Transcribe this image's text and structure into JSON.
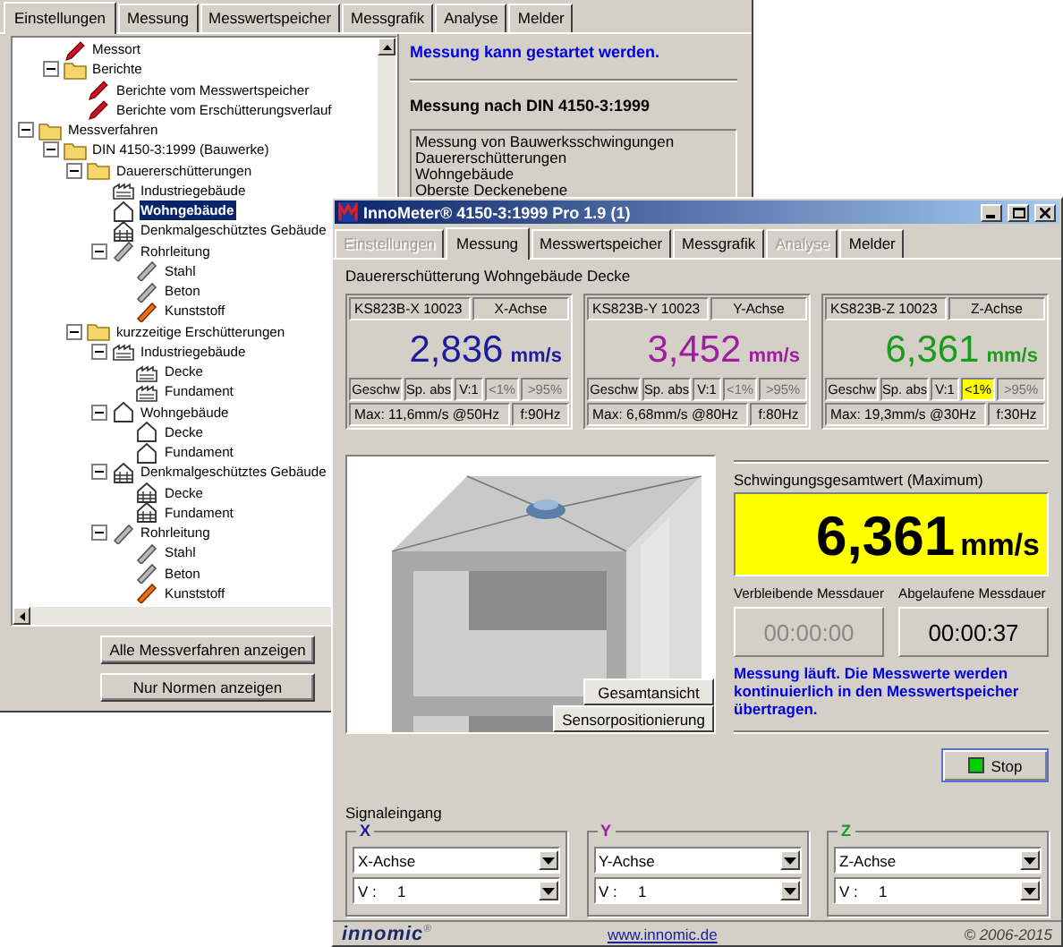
{
  "back_window": {
    "tabs": [
      {
        "label": "Einstellungen",
        "selected": true
      },
      {
        "label": "Messung",
        "selected": false
      },
      {
        "label": "Messwertspeicher",
        "selected": false
      },
      {
        "label": "Messgrafik",
        "selected": false
      },
      {
        "label": "Analyse",
        "selected": false
      },
      {
        "label": "Melder",
        "selected": false
      }
    ],
    "tree": {
      "items": [
        {
          "children": [
            {
              "label": "Messort",
              "kind": "report",
              "selected": false
            },
            {
              "label": "Berichte",
              "kind": "folder",
              "selected": false,
              "expanded": true,
              "children": [
                {
                  "label": "Berichte vom Messwertspeicher",
                  "kind": "report",
                  "selected": false
                },
                {
                  "label": "Berichte vom Erschütterungsverlauf",
                  "kind": "report",
                  "selected": false
                }
              ]
            }
          ]
        },
        {
          "label": "Messverfahren",
          "kind": "folder",
          "selected": false,
          "expanded": true,
          "children": [
            {
              "label": "DIN 4150-3:1999 (Bauwerke)",
              "kind": "folder",
              "selected": false,
              "expanded": true,
              "children": [
                {
                  "label": "Dauererschütterungen",
                  "kind": "folder",
                  "selected": false,
                  "expanded": true,
                  "children": [
                    {
                      "label": "Industriegebäude",
                      "kind": "factory",
                      "selected": false
                    },
                    {
                      "label": "Wohngebäude",
                      "kind": "house",
                      "selected": true
                    },
                    {
                      "label": "Denkmalgeschütztes Gebäude",
                      "kind": "monument",
                      "selected": false
                    },
                    {
                      "label": "Rohrleitung",
                      "kind": "pipe",
                      "selected": false,
                      "expanded": true,
                      "children": [
                        {
                          "label": "Stahl",
                          "kind": "pipe",
                          "selected": false
                        },
                        {
                          "label": "Beton",
                          "kind": "pipe",
                          "selected": false
                        },
                        {
                          "label": "Kunststoff",
                          "kind": "plastic",
                          "selected": false
                        }
                      ]
                    }
                  ]
                },
                {
                  "label": "kurzzeitige Erschütterungen",
                  "kind": "folder",
                  "selected": false,
                  "expanded": true,
                  "children": [
                    {
                      "label": "Industriegebäude",
                      "kind": "factory",
                      "selected": false,
                      "expanded": true,
                      "children": [
                        {
                          "label": "Decke",
                          "kind": "factory",
                          "selected": false
                        },
                        {
                          "label": "Fundament",
                          "kind": "factory",
                          "selected": false
                        }
                      ]
                    },
                    {
                      "label": "Wohngebäude",
                      "kind": "house",
                      "selected": false,
                      "expanded": true,
                      "children": [
                        {
                          "label": "Decke",
                          "kind": "house",
                          "selected": false
                        },
                        {
                          "label": "Fundament",
                          "kind": "house",
                          "selected": false
                        }
                      ]
                    },
                    {
                      "label": "Denkmalgeschütztes Gebäude",
                      "kind": "monument",
                      "selected": false,
                      "expanded": true,
                      "children": [
                        {
                          "label": "Decke",
                          "kind": "monument",
                          "selected": false
                        },
                        {
                          "label": "Fundament",
                          "kind": "monument",
                          "selected": false
                        }
                      ]
                    },
                    {
                      "label": "Rohrleitung",
                      "kind": "pipe",
                      "selected": false,
                      "expanded": true,
                      "children": [
                        {
                          "label": "Stahl",
                          "kind": "pipe",
                          "selected": false
                        },
                        {
                          "label": "Beton",
                          "kind": "pipe",
                          "selected": false
                        },
                        {
                          "label": "Kunststoff",
                          "kind": "plastic",
                          "selected": false
                        }
                      ]
                    }
                  ]
                }
              ]
            }
          ]
        }
      ]
    },
    "buttons": [
      "Alle Messverfahren anzeigen",
      "Nur Normen anzeigen"
    ],
    "status": "Messung kann gestartet werden.",
    "heading": "Messung nach DIN 4150-3:1999",
    "description": [
      "Messung von Bauwerksschwingungen",
      "Dauererschütterungen",
      "Wohngebäude",
      "Oberste Deckenebene"
    ]
  },
  "front_window": {
    "title": "InnoMeter® 4150-3:1999 Pro 1.9 (1)",
    "tabs": [
      {
        "label": "Einstellungen",
        "selected": false,
        "disabled": true
      },
      {
        "label": "Messung",
        "selected": true,
        "disabled": false
      },
      {
        "label": "Messwertspeicher",
        "selected": false,
        "disabled": false
      },
      {
        "label": "Messgrafik",
        "selected": false,
        "disabled": false
      },
      {
        "label": "Analyse",
        "selected": false,
        "disabled": true
      },
      {
        "label": "Melder",
        "selected": false,
        "disabled": false
      }
    ],
    "measurement_title": "Dauererschütterung Wohngebäude Decke",
    "channels": [
      {
        "sensor": "KS823B-X 10023",
        "axis": "X-Achse",
        "value": "2,836",
        "unit": "mm/s",
        "color": "#1c1c9c",
        "cells": [
          "Geschw",
          "Sp. abs",
          "V:1"
        ],
        "flags": [
          {
            "label": "<1%",
            "on": false
          },
          {
            "label": ">95%",
            "on": false
          }
        ],
        "max": "Max: 11,6mm/s @50Hz",
        "frequency": "f:90Hz"
      },
      {
        "sensor": "KS823B-Y 10023",
        "axis": "Y-Achse",
        "value": "3,452",
        "unit": "mm/s",
        "color": "#a01ca0",
        "cells": [
          "Geschw",
          "Sp. abs",
          "V:1"
        ],
        "flags": [
          {
            "label": "<1%",
            "on": false
          },
          {
            "label": ">95%",
            "on": false
          }
        ],
        "max": "Max: 6,68mm/s @80Hz",
        "frequency": "f:80Hz"
      },
      {
        "sensor": "KS823B-Z 10023",
        "axis": "Z-Achse",
        "value": "6,361",
        "unit": "mm/s",
        "color": "#1c9c1c",
        "cells": [
          "Geschw",
          "Sp. abs",
          "V:1"
        ],
        "flags": [
          {
            "label": "<1%",
            "on": true
          },
          {
            "label": ">95%",
            "on": false
          }
        ],
        "max": "Max: 19,3mm/s @30Hz",
        "frequency": "f:30Hz"
      }
    ],
    "view_buttons": [
      "Gesamtansicht",
      "Sensorpositionierung"
    ],
    "total": {
      "label": "Schwingungsgesamtwert (Maximum)",
      "value": "6,361",
      "unit": "mm/s"
    },
    "timers": [
      {
        "label": "Verbleibende Messdauer",
        "value": "00:00:00",
        "disabled": true
      },
      {
        "label": "Abgelaufene Messdauer",
        "value": "00:00:37",
        "disabled": false
      }
    ],
    "message": "Messung läuft. Die Messwerte werden kontinuierlich in den Messwertspeicher übertragen.",
    "stop_button": "Stop",
    "signal_input": {
      "label": "Signaleingang",
      "groups": [
        {
          "name": "X",
          "color": "#1c1c9c",
          "axis": "X-Achse",
          "gain_label": "V :",
          "gain": "1"
        },
        {
          "name": "Y",
          "color": "#a01ca0",
          "axis": "Y-Achse",
          "gain_label": "V :",
          "gain": "1"
        },
        {
          "name": "Z",
          "color": "#1c9c1c",
          "axis": "Z-Achse",
          "gain_label": "V :",
          "gain": "1"
        }
      ]
    },
    "footer": {
      "logo": "innomic$^{®}$",
      "link": "www.innomic.de",
      "copyright": "© 2006-2015"
    }
  }
}
